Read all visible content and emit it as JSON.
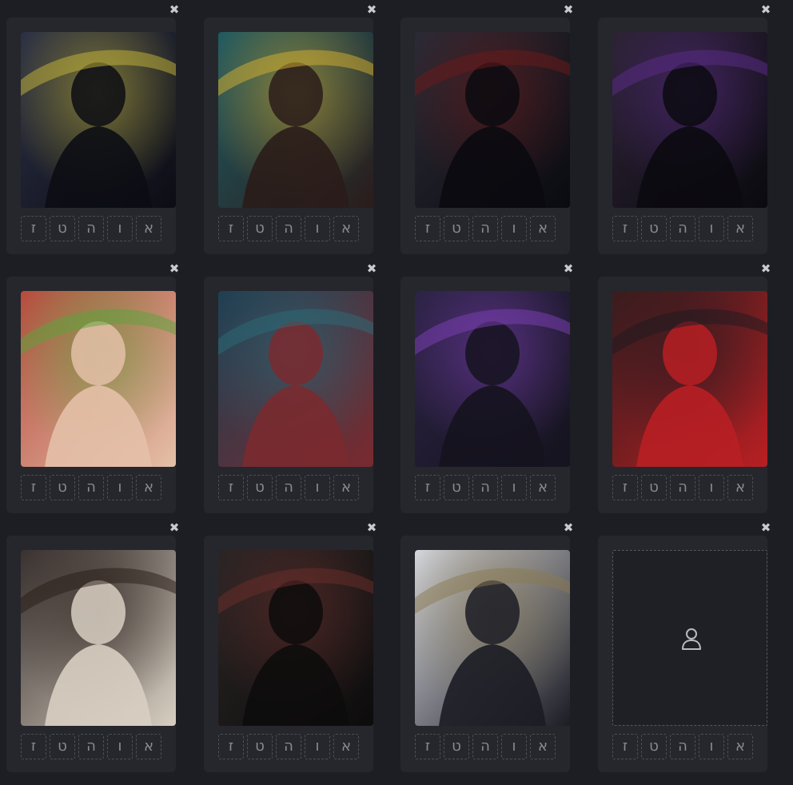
{
  "letter_buttons": [
    "ז",
    "ט",
    "ה",
    "ו",
    "א"
  ],
  "close_glyph": "✖",
  "cards": [
    {
      "palette": [
        "#2a2f45",
        "#0c0d14",
        "#c7b83a"
      ],
      "empty": false
    },
    {
      "palette": [
        "#1f5a62",
        "#2a1c1a",
        "#d8b130"
      ],
      "empty": false
    },
    {
      "palette": [
        "#2a2b36",
        "#0a0a10",
        "#6b1a1a"
      ],
      "empty": false
    },
    {
      "palette": [
        "#2c2334",
        "#0b0a10",
        "#5b2b8a"
      ],
      "empty": false
    },
    {
      "palette": [
        "#b8493d",
        "#e4c0a8",
        "#5aa33a"
      ],
      "empty": false
    },
    {
      "palette": [
        "#1e3f52",
        "#7a2a2f",
        "#2c6b78"
      ],
      "empty": false
    },
    {
      "palette": [
        "#2b2344",
        "#15131e",
        "#7e3fb8"
      ],
      "empty": false
    },
    {
      "palette": [
        "#3a1c1e",
        "#b81f23",
        "#1c1a1f"
      ],
      "empty": false
    },
    {
      "palette": [
        "#3a3230",
        "#d8cfc2",
        "#261b16"
      ],
      "empty": false
    },
    {
      "palette": [
        "#2a2525",
        "#0d0c0c",
        "#6b2e2a"
      ],
      "empty": false
    },
    {
      "palette": [
        "#d6d8de",
        "#1b1c24",
        "#8a7a52"
      ],
      "empty": false
    },
    {
      "palette": [],
      "empty": true
    }
  ]
}
